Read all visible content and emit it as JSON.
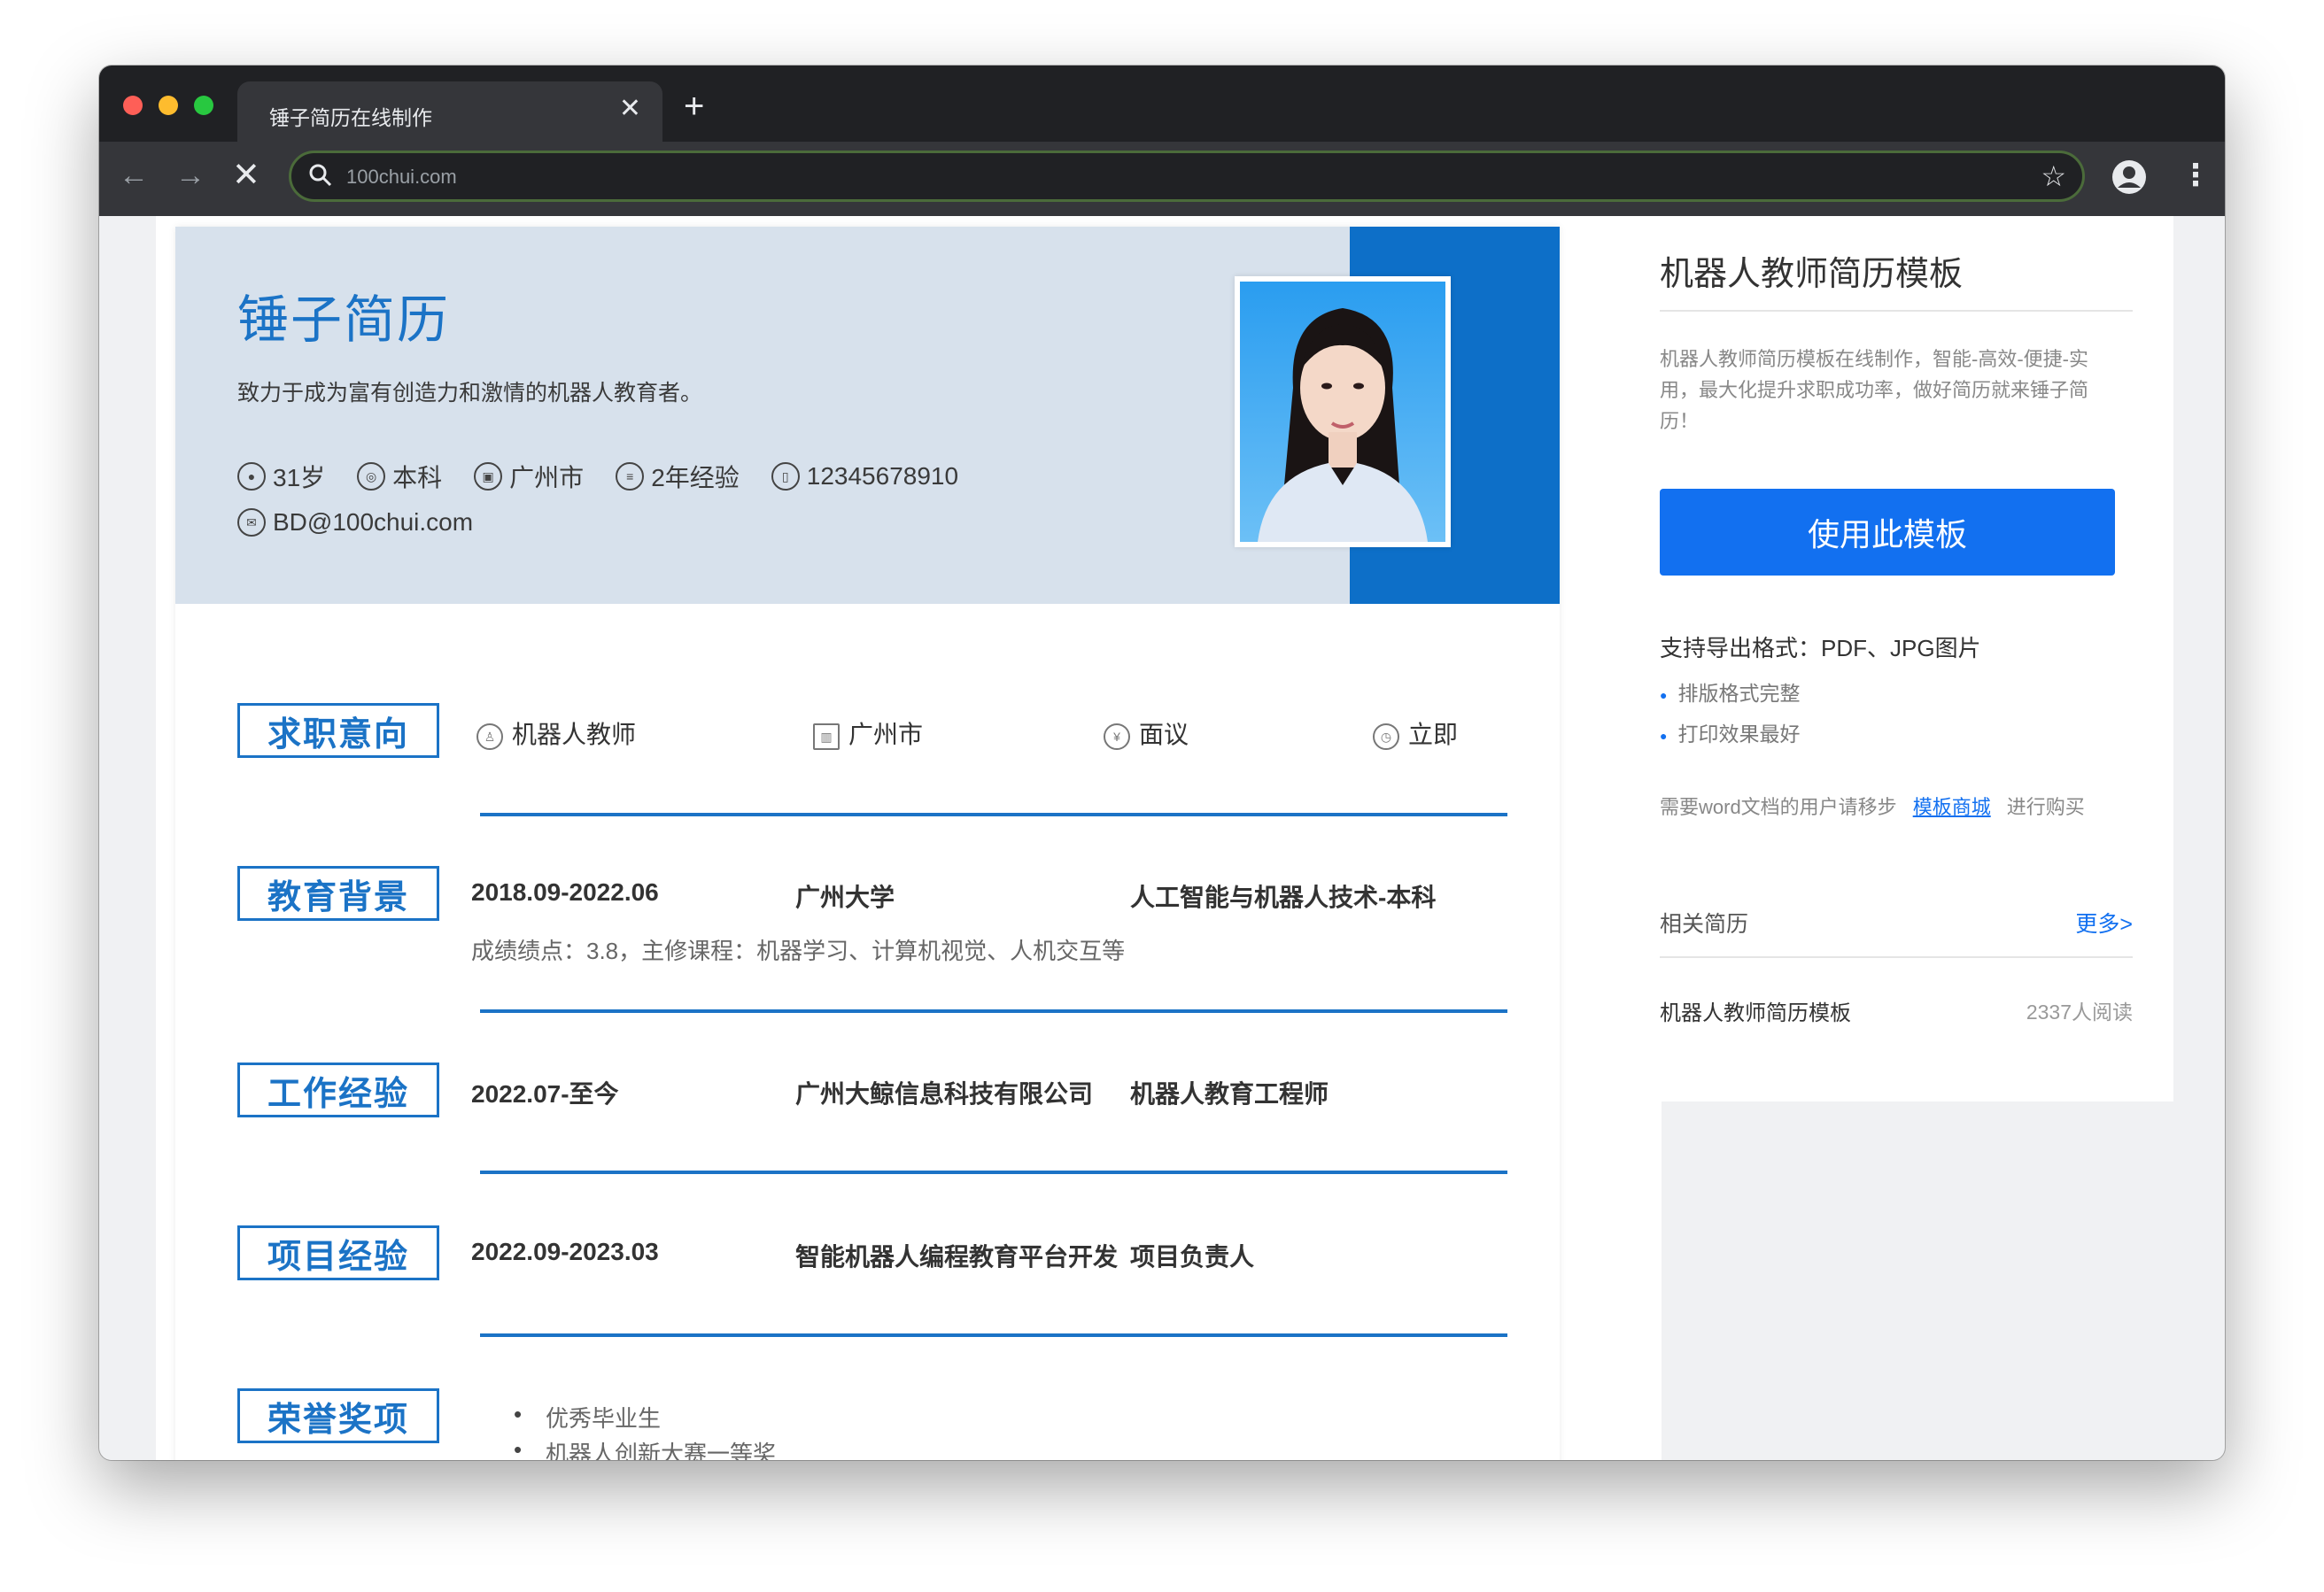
{
  "browser": {
    "tab_title": "锤子简历在线制作",
    "tab_close": "✕",
    "new_tab": "+",
    "url": "100chui.com",
    "back": "←",
    "forward": "→",
    "stop": "✕",
    "star": "☆",
    "menu": "⋮"
  },
  "resume": {
    "name": "锤子简历",
    "motto": "致力于成为富有创造力和激情的机器人教育者。",
    "info": [
      {
        "icon": "age-icon",
        "text": "31岁"
      },
      {
        "icon": "degree-icon",
        "text": "本科"
      },
      {
        "icon": "location-icon",
        "text": "广州市"
      },
      {
        "icon": "experience-icon",
        "text": "2年经验"
      },
      {
        "icon": "phone-icon",
        "text": "12345678910"
      }
    ],
    "email": "BD@100chui.com",
    "sections": {
      "intent": {
        "title": "求职意向",
        "position": "机器人教师",
        "city": "广州市",
        "salary": "面议",
        "availability": "立即"
      },
      "education": {
        "title": "教育背景",
        "period": "2018.09-2022.06",
        "school": "广州大学",
        "major": "人工智能与机器人技术-本科",
        "detail": "成绩绩点：3.8，主修课程：机器学习、计算机视觉、人机交互等"
      },
      "work": {
        "title": "工作经验",
        "period": "2022.07-至今",
        "company": "广州大鲸信息科技有限公司",
        "role": "机器人教育工程师"
      },
      "project": {
        "title": "项目经验",
        "period": "2022.09-2023.03",
        "name": "智能机器人编程教育平台开发",
        "role": "项目负责人"
      },
      "honors": {
        "title": "荣誉奖项",
        "items": [
          "优秀毕业生",
          "机器人创新大赛一等奖"
        ]
      }
    }
  },
  "sidebar": {
    "title": "机器人教师简历模板",
    "description": "机器人教师简历模板在线制作，智能-高效-便捷-实用，最大化提升求职成功率，做好简历就来锤子简历！",
    "use_button": "使用此模板",
    "formats": "支持导出格式：PDF、JPG图片",
    "features": [
      "排版格式完整",
      "打印效果最好"
    ],
    "word_prefix": "需要word文档的用户请移步",
    "word_link": "模板商城",
    "word_suffix": "进行购买",
    "related_label": "相关简历",
    "more_label": "更多>",
    "related_item": "机器人教师简历模板",
    "related_reads": "2337人阅读"
  },
  "colors": {
    "accent": "#1b73c6",
    "button": "#1270f0",
    "header_bg": "#d7e1ec"
  }
}
